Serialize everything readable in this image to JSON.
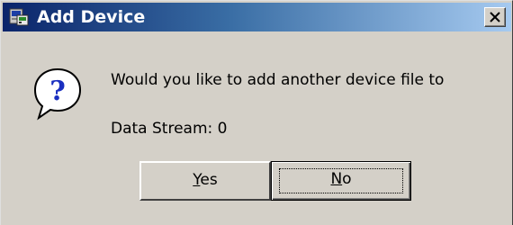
{
  "window": {
    "title": "Add Device",
    "title_icon": "device-app-icon",
    "close_icon": "close-icon"
  },
  "message": {
    "icon": "question-balloon-icon",
    "line1": "Would you like to add another device file to",
    "line2": "Data Stream: 0"
  },
  "buttons": {
    "yes_label": "Yes",
    "no_label": "No",
    "yes_mnemonic": "Y",
    "yes_rest": "es",
    "no_mnemonic": "N",
    "no_rest": "o"
  },
  "colors": {
    "title_gradient_start": "#0a246a",
    "title_gradient_end": "#a6caf0",
    "face": "#d4d0c8"
  }
}
